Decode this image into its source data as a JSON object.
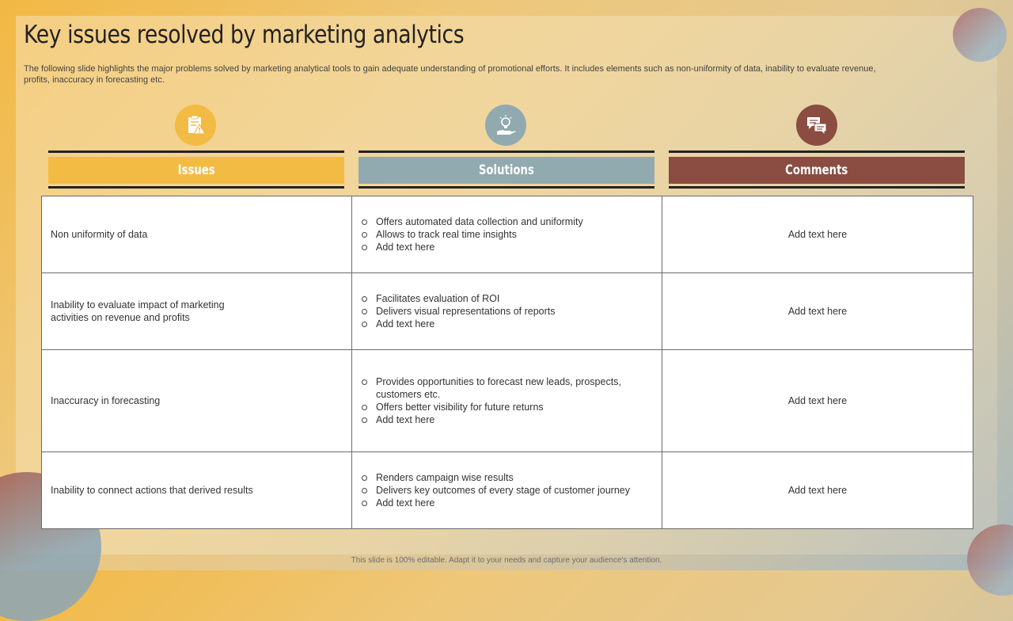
{
  "title": "Key issues resolved by marketing analytics",
  "subtitle": "The following slide highlights the major problems solved by marketing analytical tools to gain adequate understanding of promotional efforts. It includes elements such as non-uniformity of data, inability to evaluate revenue, profits, inaccuracy in forecasting etc.",
  "colors": {
    "issues": "#f2bb44",
    "solutions": "#91aab0",
    "comments": "#8b4c42"
  },
  "columns": [
    {
      "label": "Issues",
      "icon": "clipboard-warning-icon"
    },
    {
      "label": "Solutions",
      "icon": "lightbulb-hand-icon"
    },
    {
      "label": "Comments",
      "icon": "chat-bubbles-icon"
    }
  ],
  "rows": [
    {
      "issue": "Non uniformity of data",
      "solutions": [
        "Offers automated data collection and uniformity",
        "Allows to track real time insights",
        "Add text here"
      ],
      "comment": "Add text here"
    },
    {
      "issue": "Inability to evaluate  impact of marketing activities on revenue  and profits",
      "solutions": [
        "Facilitates evaluation  of ROI",
        "Delivers  visual representations  of reports",
        "Add text here"
      ],
      "comment": "Add text here"
    },
    {
      "issue": "Inaccuracy in forecasting",
      "solutions": [
        "Provides opportunities to forecast new leads, prospects, customers etc.",
        "Offers better visibility for future returns",
        "Add text here"
      ],
      "comment": "Add text here"
    },
    {
      "issue": "Inability to connect actions that derived  results",
      "solutions": [
        "Renders campaign wise results",
        "Delivers  key outcomes of every  stage of customer journey",
        "Add text here"
      ],
      "comment": "Add text here"
    }
  ],
  "footer": "This slide is 100% editable.  Adapt it to your needs and capture your audience's attention."
}
